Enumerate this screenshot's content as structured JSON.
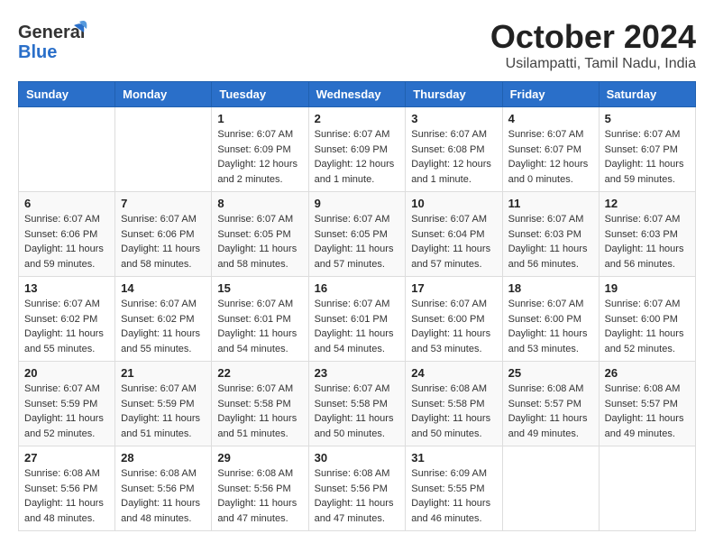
{
  "logo": {
    "general": "General",
    "blue": "Blue"
  },
  "title": "October 2024",
  "location": "Usilampatti, Tamil Nadu, India",
  "days_header": [
    "Sunday",
    "Monday",
    "Tuesday",
    "Wednesday",
    "Thursday",
    "Friday",
    "Saturday"
  ],
  "weeks": [
    [
      {
        "day": "",
        "info": ""
      },
      {
        "day": "",
        "info": ""
      },
      {
        "day": "1",
        "info": "Sunrise: 6:07 AM\nSunset: 6:09 PM\nDaylight: 12 hours\nand 2 minutes."
      },
      {
        "day": "2",
        "info": "Sunrise: 6:07 AM\nSunset: 6:09 PM\nDaylight: 12 hours\nand 1 minute."
      },
      {
        "day": "3",
        "info": "Sunrise: 6:07 AM\nSunset: 6:08 PM\nDaylight: 12 hours\nand 1 minute."
      },
      {
        "day": "4",
        "info": "Sunrise: 6:07 AM\nSunset: 6:07 PM\nDaylight: 12 hours\nand 0 minutes."
      },
      {
        "day": "5",
        "info": "Sunrise: 6:07 AM\nSunset: 6:07 PM\nDaylight: 11 hours\nand 59 minutes."
      }
    ],
    [
      {
        "day": "6",
        "info": "Sunrise: 6:07 AM\nSunset: 6:06 PM\nDaylight: 11 hours\nand 59 minutes."
      },
      {
        "day": "7",
        "info": "Sunrise: 6:07 AM\nSunset: 6:06 PM\nDaylight: 11 hours\nand 58 minutes."
      },
      {
        "day": "8",
        "info": "Sunrise: 6:07 AM\nSunset: 6:05 PM\nDaylight: 11 hours\nand 58 minutes."
      },
      {
        "day": "9",
        "info": "Sunrise: 6:07 AM\nSunset: 6:05 PM\nDaylight: 11 hours\nand 57 minutes."
      },
      {
        "day": "10",
        "info": "Sunrise: 6:07 AM\nSunset: 6:04 PM\nDaylight: 11 hours\nand 57 minutes."
      },
      {
        "day": "11",
        "info": "Sunrise: 6:07 AM\nSunset: 6:03 PM\nDaylight: 11 hours\nand 56 minutes."
      },
      {
        "day": "12",
        "info": "Sunrise: 6:07 AM\nSunset: 6:03 PM\nDaylight: 11 hours\nand 56 minutes."
      }
    ],
    [
      {
        "day": "13",
        "info": "Sunrise: 6:07 AM\nSunset: 6:02 PM\nDaylight: 11 hours\nand 55 minutes."
      },
      {
        "day": "14",
        "info": "Sunrise: 6:07 AM\nSunset: 6:02 PM\nDaylight: 11 hours\nand 55 minutes."
      },
      {
        "day": "15",
        "info": "Sunrise: 6:07 AM\nSunset: 6:01 PM\nDaylight: 11 hours\nand 54 minutes."
      },
      {
        "day": "16",
        "info": "Sunrise: 6:07 AM\nSunset: 6:01 PM\nDaylight: 11 hours\nand 54 minutes."
      },
      {
        "day": "17",
        "info": "Sunrise: 6:07 AM\nSunset: 6:00 PM\nDaylight: 11 hours\nand 53 minutes."
      },
      {
        "day": "18",
        "info": "Sunrise: 6:07 AM\nSunset: 6:00 PM\nDaylight: 11 hours\nand 53 minutes."
      },
      {
        "day": "19",
        "info": "Sunrise: 6:07 AM\nSunset: 6:00 PM\nDaylight: 11 hours\nand 52 minutes."
      }
    ],
    [
      {
        "day": "20",
        "info": "Sunrise: 6:07 AM\nSunset: 5:59 PM\nDaylight: 11 hours\nand 52 minutes."
      },
      {
        "day": "21",
        "info": "Sunrise: 6:07 AM\nSunset: 5:59 PM\nDaylight: 11 hours\nand 51 minutes."
      },
      {
        "day": "22",
        "info": "Sunrise: 6:07 AM\nSunset: 5:58 PM\nDaylight: 11 hours\nand 51 minutes."
      },
      {
        "day": "23",
        "info": "Sunrise: 6:07 AM\nSunset: 5:58 PM\nDaylight: 11 hours\nand 50 minutes."
      },
      {
        "day": "24",
        "info": "Sunrise: 6:08 AM\nSunset: 5:58 PM\nDaylight: 11 hours\nand 50 minutes."
      },
      {
        "day": "25",
        "info": "Sunrise: 6:08 AM\nSunset: 5:57 PM\nDaylight: 11 hours\nand 49 minutes."
      },
      {
        "day": "26",
        "info": "Sunrise: 6:08 AM\nSunset: 5:57 PM\nDaylight: 11 hours\nand 49 minutes."
      }
    ],
    [
      {
        "day": "27",
        "info": "Sunrise: 6:08 AM\nSunset: 5:56 PM\nDaylight: 11 hours\nand 48 minutes."
      },
      {
        "day": "28",
        "info": "Sunrise: 6:08 AM\nSunset: 5:56 PM\nDaylight: 11 hours\nand 48 minutes."
      },
      {
        "day": "29",
        "info": "Sunrise: 6:08 AM\nSunset: 5:56 PM\nDaylight: 11 hours\nand 47 minutes."
      },
      {
        "day": "30",
        "info": "Sunrise: 6:08 AM\nSunset: 5:56 PM\nDaylight: 11 hours\nand 47 minutes."
      },
      {
        "day": "31",
        "info": "Sunrise: 6:09 AM\nSunset: 5:55 PM\nDaylight: 11 hours\nand 46 minutes."
      },
      {
        "day": "",
        "info": ""
      },
      {
        "day": "",
        "info": ""
      }
    ]
  ]
}
